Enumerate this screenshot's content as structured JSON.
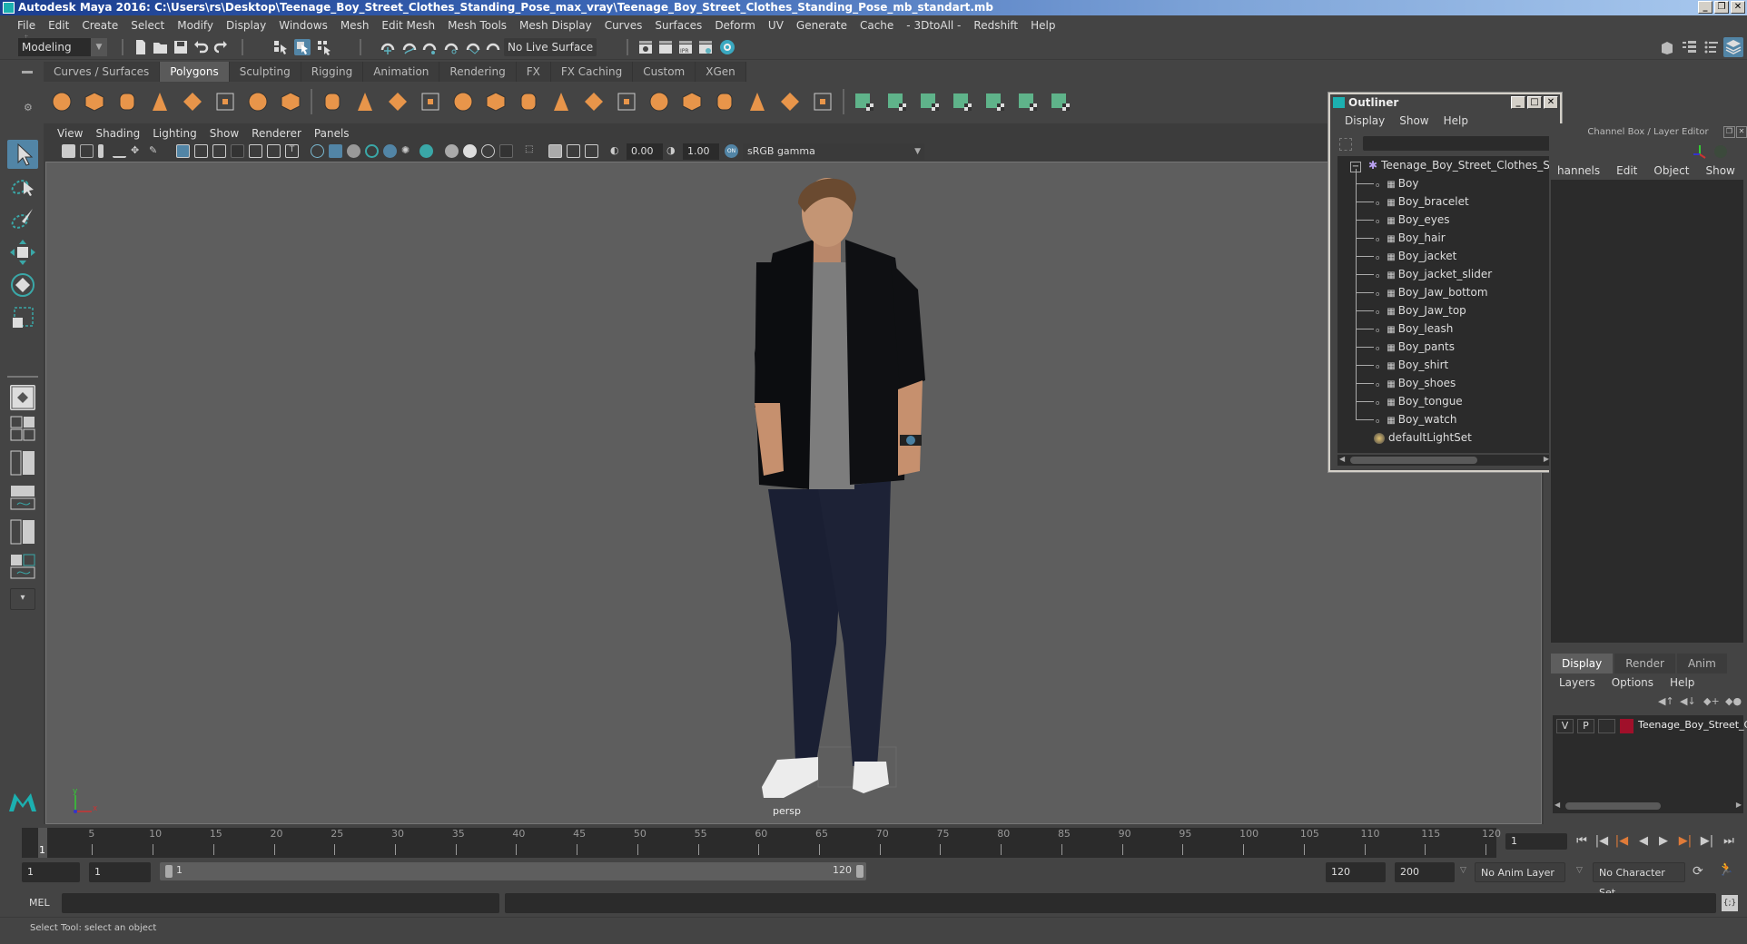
{
  "window": {
    "title": "Autodesk Maya 2016: C:\\Users\\rs\\Desktop\\Teenage_Boy_Street_Clothes_Standing_Pose_max_vray\\Teenage_Boy_Street_Clothes_Standing_Pose_mb_standart.mb",
    "buttons": {
      "minimize": "_",
      "restore": "❐",
      "close": "✕"
    }
  },
  "menubar": [
    "File",
    "Edit",
    "Create",
    "Select",
    "Modify",
    "Display",
    "Windows",
    "Mesh",
    "Edit Mesh",
    "Mesh Tools",
    "Mesh Display",
    "Curves",
    "Surfaces",
    "Deform",
    "UV",
    "Generate",
    "Cache",
    "- 3DtoAll -",
    "Redshift",
    "Help"
  ],
  "statusline": {
    "mode": "Modeling",
    "live_surface": "No Live Surface"
  },
  "shelf": {
    "tabs": [
      {
        "label": "Curves / Surfaces",
        "active": false
      },
      {
        "label": "Polygons",
        "active": true
      },
      {
        "label": "Sculpting",
        "active": false
      },
      {
        "label": "Rigging",
        "active": false
      },
      {
        "label": "Animation",
        "active": false
      },
      {
        "label": "Rendering",
        "active": false
      },
      {
        "label": "FX",
        "active": false
      },
      {
        "label": "FX Caching",
        "active": false
      },
      {
        "label": "Custom",
        "active": false
      },
      {
        "label": "XGen",
        "active": false
      }
    ],
    "icons": [
      "poly-sphere-icon",
      "poly-cube-icon",
      "poly-cylinder-icon",
      "poly-cone-icon",
      "poly-plane-icon",
      "poly-torus-icon",
      "poly-pyramid-icon",
      "poly-pipe-icon",
      "combine-icon",
      "separate-icon",
      "mirror-icon",
      "smooth-icon",
      "bevel-icon",
      "bridge-icon",
      "multi-cut-icon",
      "extrude-icon",
      "merge-icon",
      "fill-hole-icon",
      "append-icon",
      "insert-edge-loop-icon",
      "offset-edge-loop-icon",
      "triangulate-icon",
      "quadrangulate-icon",
      "sculpt-icon",
      "uv-planar-icon",
      "uv-cylindrical-icon",
      "uv-spherical-icon",
      "uv-automatic-icon",
      "uv-unfold-icon",
      "uv-editor-icon",
      "uv-layout-icon"
    ]
  },
  "viewport": {
    "menu": [
      "View",
      "Shading",
      "Lighting",
      "Show",
      "Renderer",
      "Panels"
    ],
    "exposure": "0.00",
    "gamma": "1.00",
    "color_space": "sRGB gamma",
    "color_mgmt_badge": "ON",
    "camera_label": "persp",
    "axis": {
      "x": "x",
      "y": "y",
      "z": "z"
    }
  },
  "outliner": {
    "title": "Outliner",
    "menu": [
      "Display",
      "Show",
      "Help"
    ],
    "root": "Teenage_Boy_Street_Clothes_Star",
    "children": [
      "Boy",
      "Boy_bracelet",
      "Boy_eyes",
      "Boy_hair",
      "Boy_jacket",
      "Boy_jacket_slider",
      "Boy_Jaw_bottom",
      "Boy_Jaw_top",
      "Boy_leash",
      "Boy_pants",
      "Boy_shirt",
      "Boy_shoes",
      "Boy_tongue",
      "Boy_watch"
    ],
    "sets": [
      "defaultLightSet"
    ]
  },
  "channel_box": {
    "title": "Channel Box / Layer Editor",
    "menu": [
      "hannels",
      "Edit",
      "Object",
      "Show"
    ]
  },
  "layer_editor": {
    "tabs": [
      {
        "label": "Display",
        "active": true
      },
      {
        "label": "Render",
        "active": false
      },
      {
        "label": "Anim",
        "active": false
      }
    ],
    "menu": [
      "Layers",
      "Options",
      "Help"
    ],
    "layers": [
      {
        "visible": "V",
        "playback": "P",
        "color": "#a0102a",
        "name": "Teenage_Boy_Street_C"
      }
    ]
  },
  "timeline": {
    "ticks": [
      "5",
      "10",
      "15",
      "20",
      "25",
      "30",
      "35",
      "40",
      "45",
      "50",
      "55",
      "60",
      "65",
      "70",
      "75",
      "80",
      "85",
      "90",
      "95",
      "100",
      "105",
      "110",
      "115",
      "120"
    ],
    "current_marker": "1",
    "current_frame": "1",
    "range_min": 1,
    "range_max": 120
  },
  "range": {
    "start": "1",
    "playback_start": "1",
    "slider_start": "1",
    "slider_end": "120",
    "playback_end": "120",
    "end": "200",
    "anim_layer": "No Anim Layer",
    "character_set": "No Character Set"
  },
  "command_line": {
    "label": "MEL",
    "value": "",
    "result": ""
  },
  "help_line": "Select Tool: select an object",
  "colors": {
    "accent_blue": "#5285a6",
    "shelf_orange": "#e8954a",
    "shelf_green": "#5fb38a",
    "layer_color": "#a0102a",
    "key_orange": "#e07b39"
  }
}
